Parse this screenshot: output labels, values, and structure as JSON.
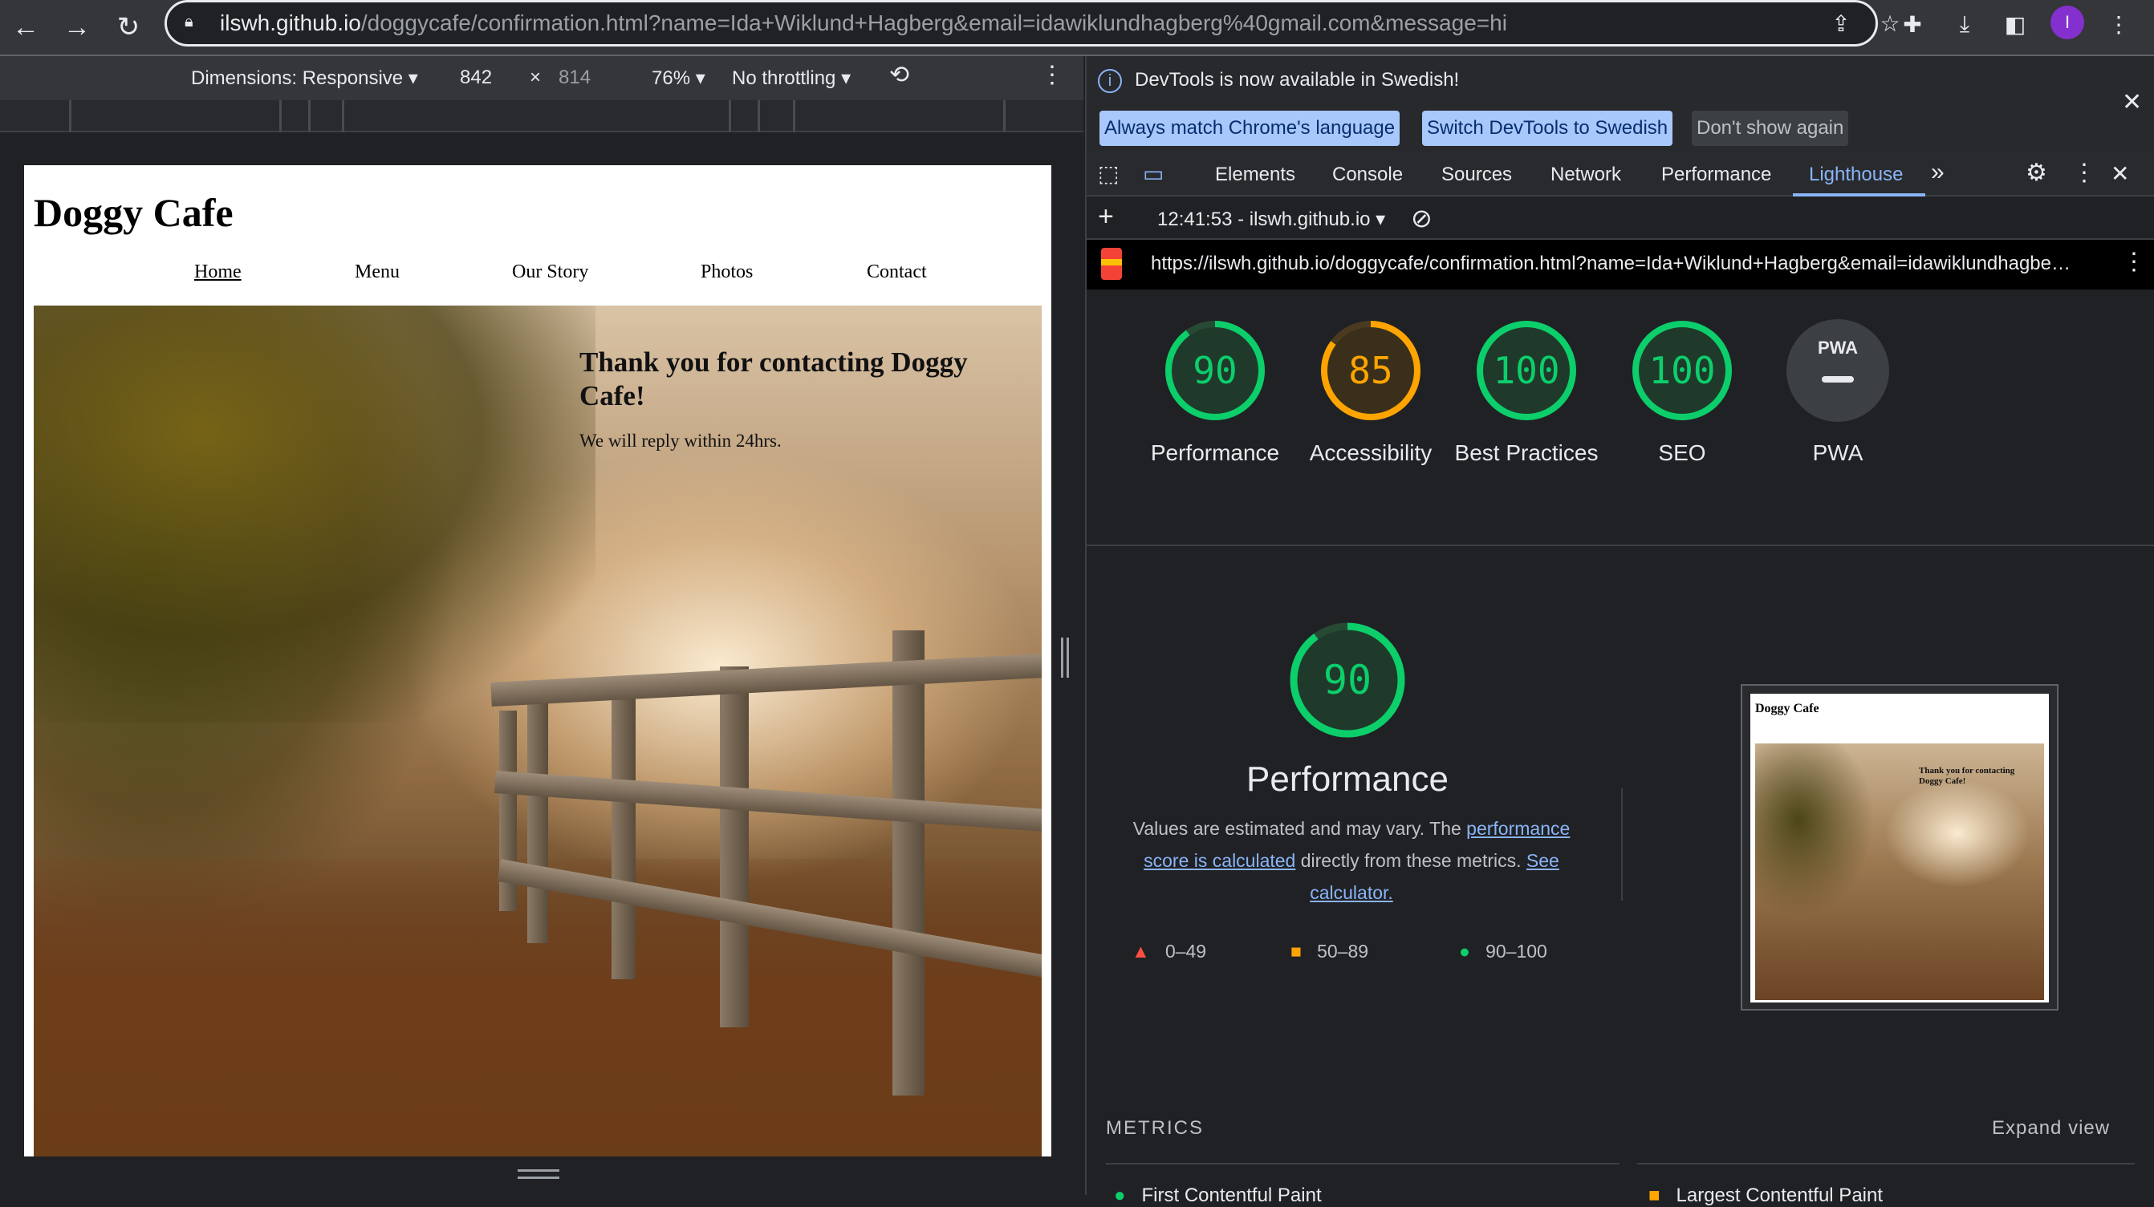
{
  "browser": {
    "url_host": "ilswh.github.io",
    "url_path": "/doggycafe/confirmation.html?name=Ida+Wiklund+Hagberg&email=idawiklundhagberg%40gmail.com&message=hi",
    "profile_initial": "I"
  },
  "device_toolbar": {
    "dimensions": "Dimensions: Responsive ▾",
    "width": "842",
    "times": "×",
    "height": "814",
    "zoom": "76% ▾",
    "throttling": "No throttling ▾"
  },
  "site": {
    "title": "Doggy Cafe",
    "nav": [
      "Home",
      "Menu",
      "Our Story",
      "Photos",
      "Contact"
    ],
    "thanks_title": "Thank you for contacting Doggy Cafe!",
    "thanks_sub": "We will reply within 24hrs."
  },
  "devtools": {
    "info_text": "DevTools is now available in Swedish!",
    "info_btn_match": "Always match Chrome's language",
    "info_btn_switch": "Switch DevTools to Swedish",
    "info_btn_dont": "Don't show again",
    "tabs": [
      "Elements",
      "Console",
      "Sources",
      "Network",
      "Performance",
      "Lighthouse"
    ],
    "report_time": "12:41:53 - ilswh.github.io ▾",
    "report_url": "https://ilswh.github.io/doggycafe/confirmation.html?name=Ida+Wiklund+Hagberg&email=idawiklundhagbe…",
    "scores": [
      {
        "value": "90",
        "label": "Performance",
        "status": "good"
      },
      {
        "value": "85",
        "label": "Accessibility",
        "status": "average"
      },
      {
        "value": "100",
        "label": "Best Practices",
        "status": "good"
      },
      {
        "value": "100",
        "label": "SEO",
        "status": "good"
      },
      {
        "value": "PWA",
        "label": "PWA",
        "status": "na"
      }
    ],
    "perf": {
      "value": "90",
      "title": "Performance",
      "desc_1": "Values are estimated and may vary. The ",
      "desc_link1": "performance score is calculated",
      "desc_2": " directly from these metrics. ",
      "desc_link2": "See calculator."
    },
    "legend": [
      "0–49",
      "50–89",
      "90–100"
    ],
    "metrics_heading": "METRICS",
    "expand_view": "Expand view",
    "metrics": [
      "First Contentful Paint",
      "Largest Contentful Paint"
    ],
    "colors": {
      "good": "#0cce6b",
      "average": "#ffa400",
      "poor": "#ff4e42",
      "accent": "#8ab4f8"
    }
  }
}
